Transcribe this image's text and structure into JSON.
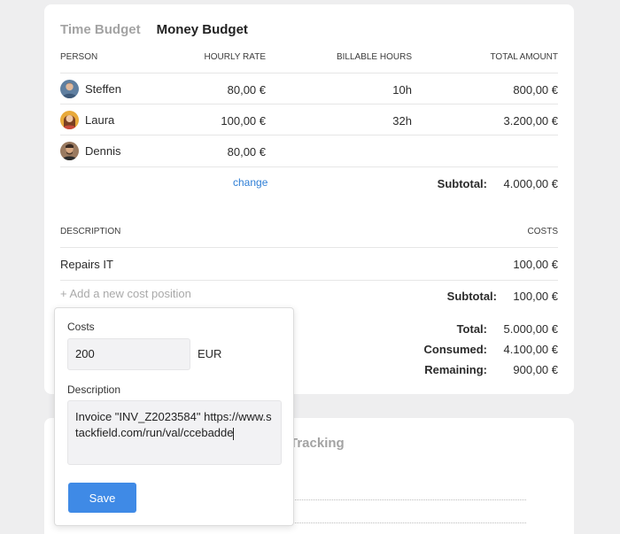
{
  "tabs": {
    "time": "Time Budget",
    "money": "Money Budget"
  },
  "people_table": {
    "headers": {
      "person": "PERSON",
      "rate": "HOURLY RATE",
      "hours": "BILLABLE HOURS",
      "total": "TOTAL AMOUNT"
    },
    "rows": [
      {
        "name": "Steffen",
        "rate": "80,00 €",
        "hours": "10h",
        "total": "800,00 €"
      },
      {
        "name": "Laura",
        "rate": "100,00 €",
        "hours": "32h",
        "total": "3.200,00 €"
      },
      {
        "name": "Dennis",
        "rate": "80,00 €",
        "hours": "",
        "total": ""
      }
    ],
    "change_label": "change",
    "subtotal_label": "Subtotal:",
    "subtotal_value": "4.000,00 €"
  },
  "costs_table": {
    "headers": {
      "description": "DESCRIPTION",
      "costs": "COSTS"
    },
    "rows": [
      {
        "description": "Repairs IT",
        "cost": "100,00 €"
      }
    ],
    "add_label": "+ Add a new cost position",
    "subtotal_label": "Subtotal:",
    "subtotal_value": "100,00 €"
  },
  "summary": {
    "total_label": "Total:",
    "total_value": "5.000,00 €",
    "consumed_label": "Consumed:",
    "consumed_value": "4.100,00 €",
    "remaining_label": "Remaining:",
    "remaining_value": "900,00 €"
  },
  "popup": {
    "costs_label": "Costs",
    "costs_value": "200",
    "currency": "EUR",
    "description_label": "Description",
    "description_value": "Invoice \"INV_Z2023584\" https://www.stackfield.com/run/val/ccebadde",
    "save_label": "Save"
  },
  "second_card": {
    "title_fragment": "Tracking"
  },
  "colors": {
    "accent": "#3f8ae6",
    "link": "#2f7fd6",
    "muted": "#a3a3a3"
  }
}
